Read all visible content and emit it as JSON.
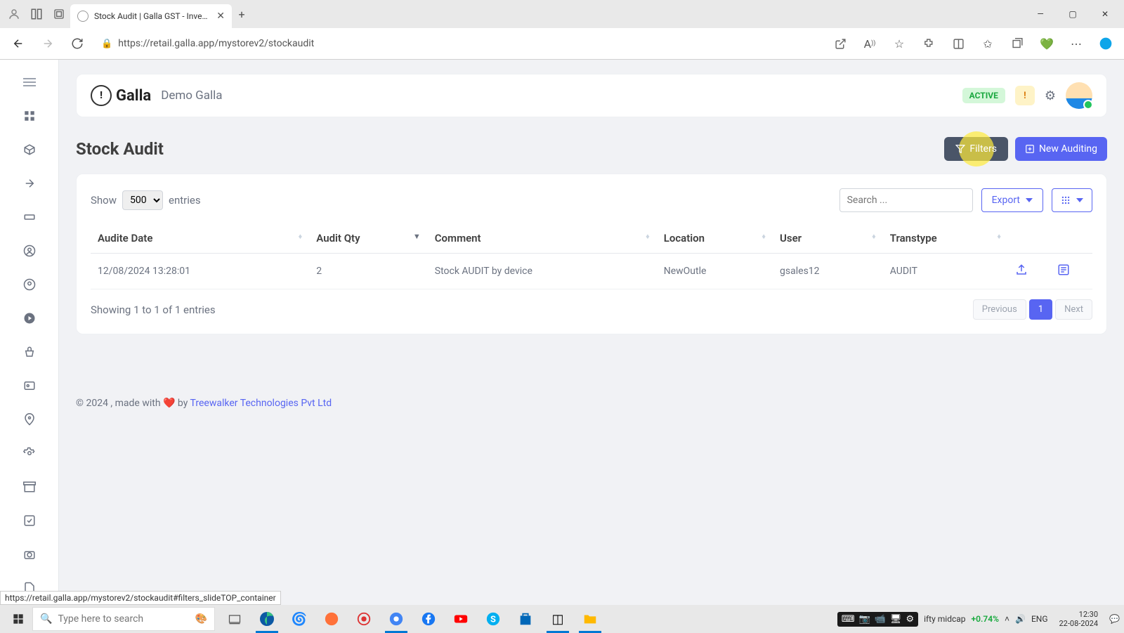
{
  "browser": {
    "tab_title": "Stock Audit | Galla GST - Invento",
    "url": "https://retail.galla.app/mystorev2/stockaudit",
    "status_link": "https://retail.galla.app/mystorev2/stockaudit#filters_slideTOP_container"
  },
  "topbar": {
    "logo_text": "Galla",
    "store_name": "Demo Galla",
    "status_badge": "ACTIVE",
    "notif_badge": "!"
  },
  "page": {
    "title": "Stock Audit",
    "filters_btn": "Filters",
    "new_btn": "New Auditing"
  },
  "toolbar": {
    "show_label": "Show",
    "entries_select": "500",
    "entries_suffix": "entries",
    "search_placeholder": "Search ...",
    "export_label": "Export"
  },
  "table": {
    "headers": {
      "date": "Audite Date",
      "qty": "Audit Qty",
      "comment": "Comment",
      "location": "Location",
      "user": "User",
      "transtype": "Transtype"
    },
    "rows": [
      {
        "date": "12/08/2024 13:28:01",
        "qty": "2",
        "comment": "Stock AUDIT by device",
        "location": "NewOutle",
        "user": "gsales12",
        "transtype": "AUDIT"
      }
    ],
    "footer_info": "Showing 1 to 1 of 1 entries",
    "prev": "Previous",
    "page1": "1",
    "next": "Next"
  },
  "footer": {
    "text_prefix": "© 2024 , made with ❤️ by ",
    "link_text": "Treewalker Technologies Pvt Ltd"
  },
  "taskbar": {
    "search_placeholder": "Type here to search",
    "ticker_label": "ifty midcap",
    "ticker_value": "+0.74%",
    "lang": "ENG",
    "time": "12:30",
    "date": "22-08-2024"
  }
}
